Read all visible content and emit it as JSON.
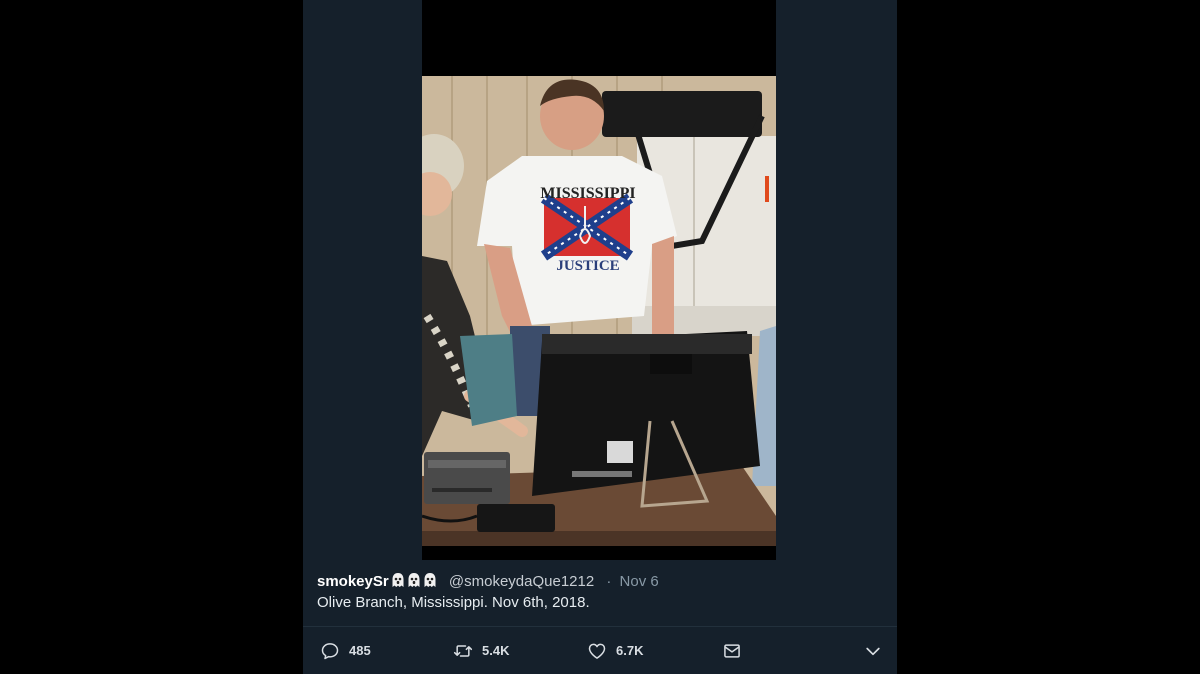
{
  "tweet": {
    "display_name": "smokeySr",
    "name_emojis": [
      "ghost-icon",
      "ghost-icon",
      "ghost-icon"
    ],
    "handle": "@smokeydaQue1212",
    "separator": "·",
    "time": "Nov 6",
    "text": "Olive Branch, Mississippi. Nov 6th, 2018."
  },
  "photo": {
    "shirt_text_top": "MISSISSIPPI",
    "shirt_text_bottom": "JUSTICE"
  },
  "actions": {
    "reply": {
      "icon": "reply-icon",
      "count": "485"
    },
    "retweet": {
      "icon": "retweet-icon",
      "count": "5.4K"
    },
    "like": {
      "icon": "heart-icon",
      "count": "6.7K"
    },
    "dm": {
      "icon": "mail-icon"
    },
    "more": {
      "icon": "chevron-down-icon"
    }
  },
  "colors": {
    "page_bg": "#000000",
    "panel_bg": "#15202b",
    "text": "#e6ecf0",
    "muted": "#8899a6"
  }
}
